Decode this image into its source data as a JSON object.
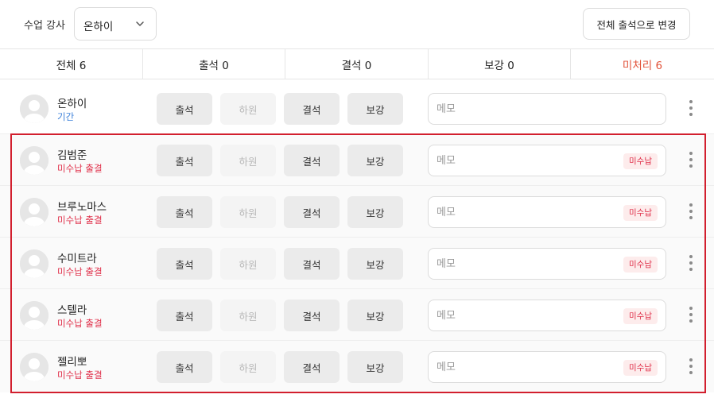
{
  "header": {
    "teacher_label": "수업 강사",
    "teacher_selected": "온하이",
    "bulk_button": "전체 출석으로 변경"
  },
  "tabs": [
    {
      "label": "전체 6"
    },
    {
      "label": "출석 0"
    },
    {
      "label": "결석 0"
    },
    {
      "label": "보강 0"
    },
    {
      "label": "미처리 6"
    }
  ],
  "actions": {
    "attend": "출석",
    "leave": "하원",
    "absent": "결석",
    "makeup": "보강"
  },
  "memo_placeholder": "메모",
  "students": [
    {
      "name": "온하이",
      "status": "기간",
      "badge": ""
    },
    {
      "name": "김범준",
      "status": "미수납 출결",
      "badge": "미수납"
    },
    {
      "name": "브루노마스",
      "status": "미수납 출결",
      "badge": "미수납"
    },
    {
      "name": "수미트라",
      "status": "미수납 출결",
      "badge": "미수납"
    },
    {
      "name": "스텔라",
      "status": "미수납 출결",
      "badge": "미수납"
    },
    {
      "name": "젤리뽀",
      "status": "미수납 출결",
      "badge": "미수납"
    }
  ],
  "colors": {
    "pending": "#e2533a",
    "unpaid": "#e0304a",
    "period": "#3a7fd8",
    "highlight": "#d21f2e"
  }
}
